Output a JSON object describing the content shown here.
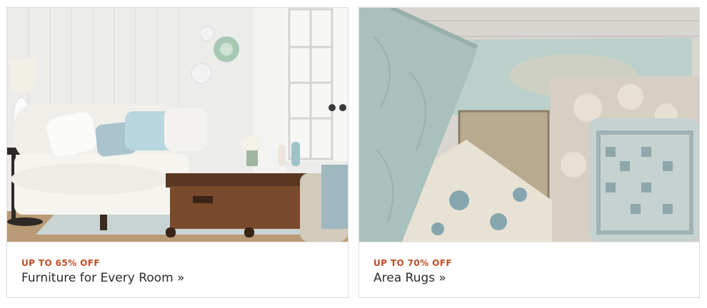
{
  "cards": [
    {
      "image_description": "living room with white sofa and wooden trunk coffee table",
      "promo": "UP TO 65% OFF",
      "title": "Furniture for Every Room »",
      "colors": {
        "promo": "#c04d26",
        "title": "#2b2b2b"
      }
    },
    {
      "image_description": "stack of area rugs in sage, beige and blue tones",
      "promo": "UP TO 70% OFF",
      "title": "Area Rugs »",
      "colors": {
        "promo": "#c04d26",
        "title": "#2b2b2b"
      }
    }
  ]
}
